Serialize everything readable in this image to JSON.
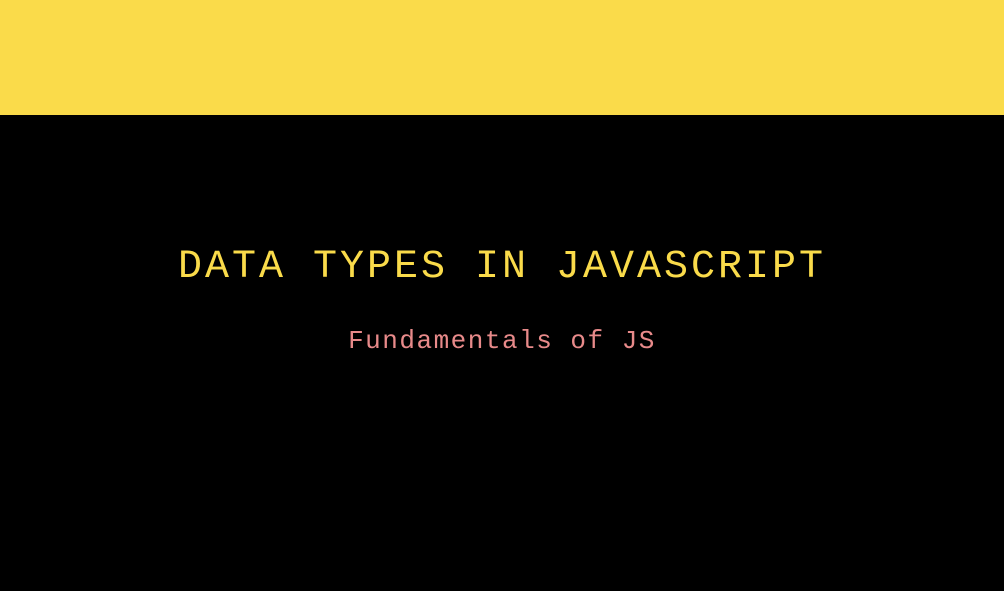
{
  "slide": {
    "title": "DATA TYPES IN JAVASCRIPT",
    "subtitle": "Fundamentals of JS"
  },
  "colors": {
    "accent": "#fadb4a",
    "subtitle": "#e88a8a",
    "background": "#000000"
  }
}
